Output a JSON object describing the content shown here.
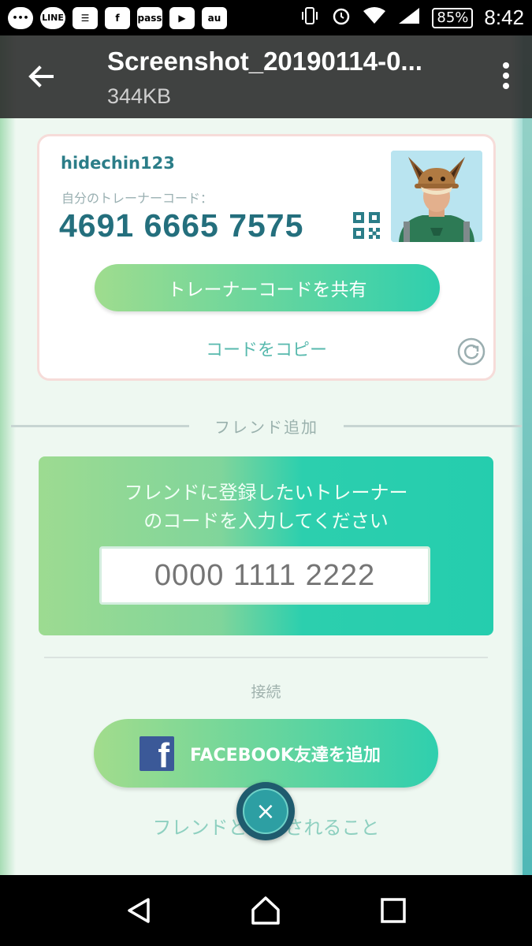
{
  "status_bar": {
    "icons": [
      "more-icon",
      "line-icon",
      "contacts-icon",
      "facebook-icon",
      "pass-icon",
      "youtube-icon",
      "au-mail-icon"
    ],
    "line_text": "LINE",
    "pass_text": "pass",
    "au_text": "au",
    "battery": "85%",
    "time": "8:42"
  },
  "viewer": {
    "file_name": "Screenshot_20190114-0...",
    "file_size": "344KB"
  },
  "trainer_card": {
    "username": "hidechin123",
    "code_label": "自分のトレーナーコード：",
    "trainer_code": "4691 6665 7575",
    "share_button": "トレーナーコードを共有",
    "copy_link": "コードをコピー"
  },
  "add_friend": {
    "section_label": "フレンド追加",
    "prompt": "フレンドに登録したいトレーナーのコードを入力してください",
    "input_placeholder": "0000 1111 2222"
  },
  "connect": {
    "section_label": "接続",
    "facebook_button": "FACEBOOK友達を追加",
    "friend_list_label": "フレンドと　　されること"
  },
  "colors": {
    "accent_teal": "#2fcfae",
    "accent_green": "#9fdc8e",
    "code_text": "#246f7d",
    "facebook_blue": "#3b5998"
  }
}
